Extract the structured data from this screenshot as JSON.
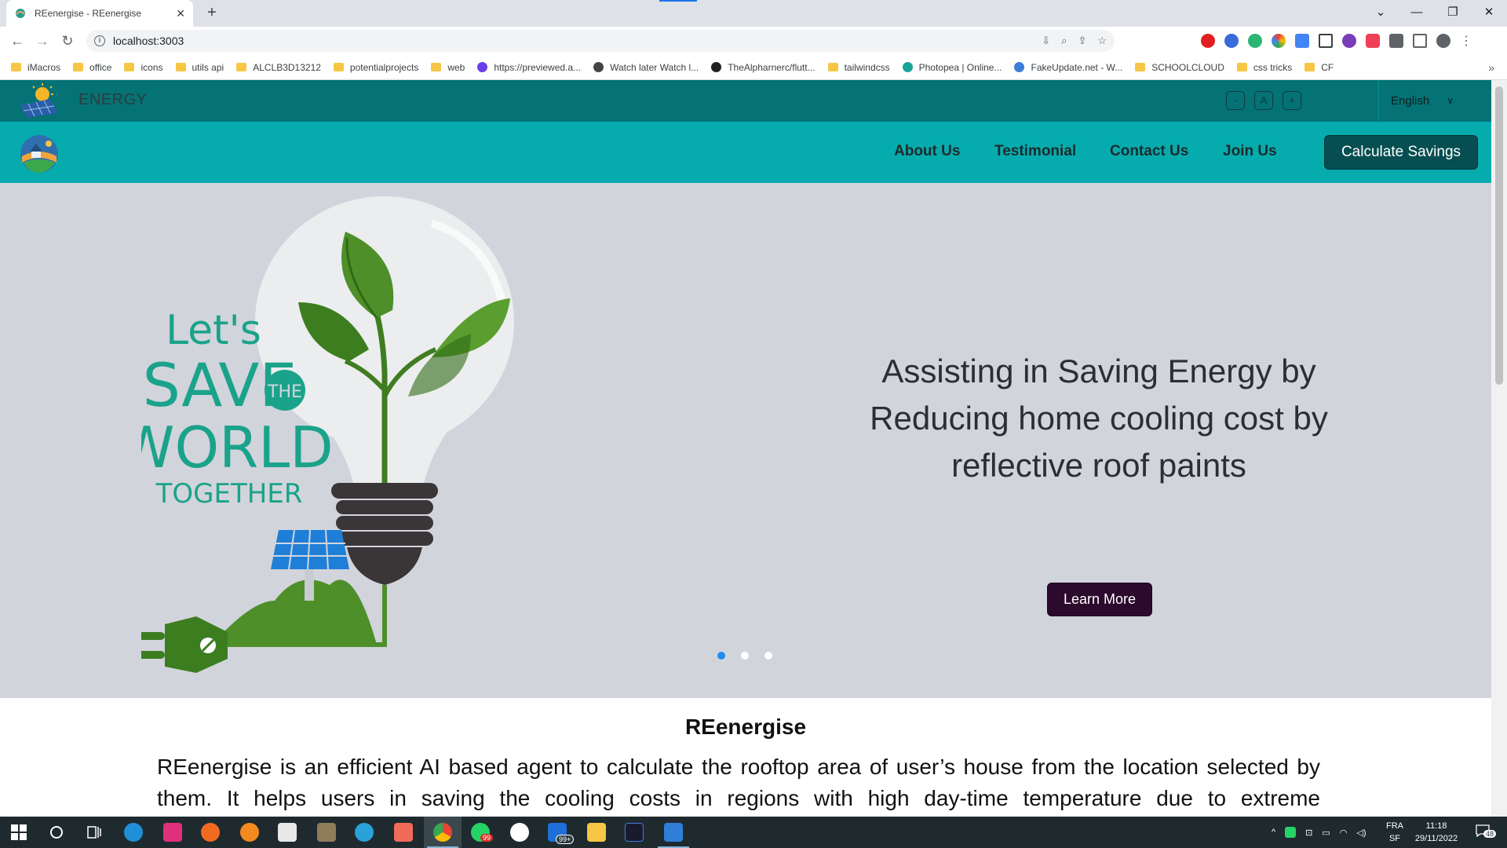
{
  "browser": {
    "tab_title": "REenergise - REenergise",
    "tab_close": "✕",
    "new_tab": "+",
    "url": "localhost:3003",
    "bookmarks": [
      {
        "label": "iMacros",
        "kind": "folder"
      },
      {
        "label": "office",
        "kind": "folder"
      },
      {
        "label": "icons",
        "kind": "folder"
      },
      {
        "label": "utils api",
        "kind": "folder"
      },
      {
        "label": "ALCLB3D13212",
        "kind": "folder"
      },
      {
        "label": "potentialprojects",
        "kind": "folder"
      },
      {
        "label": "web",
        "kind": "folder"
      },
      {
        "label": "https://previewed.a...",
        "kind": "site",
        "color": "#6a3de8"
      },
      {
        "label": "Watch later Watch l...",
        "kind": "site",
        "color": "#444444"
      },
      {
        "label": "TheAlpharnerc/flutt...",
        "kind": "site",
        "color": "#222222"
      },
      {
        "label": "tailwindcss",
        "kind": "folder"
      },
      {
        "label": "Photopea | Online...",
        "kind": "site",
        "color": "#18a497"
      },
      {
        "label": "FakeUpdate.net - W...",
        "kind": "site",
        "color": "#3b7dd8"
      },
      {
        "label": "SCHOOLCLOUD",
        "kind": "folder"
      },
      {
        "label": "css tricks",
        "kind": "folder"
      },
      {
        "label": "CF",
        "kind": "folder"
      }
    ],
    "bookmarks_more": "»"
  },
  "site": {
    "brand_name": "ENERGY",
    "font_controls": [
      "-",
      "A",
      "+"
    ],
    "language": "English",
    "nav_links": [
      "About Us",
      "Testimonial",
      "Contact Us",
      "Join Us"
    ],
    "cta_label": "Calculate Savings",
    "hero": {
      "art_text": {
        "lets": "Let's",
        "save": "SAVE",
        "the": "THE",
        "world": "WORLD",
        "together": "TOGETHER"
      },
      "headline": "Assisting in Saving Energy by Reducing home cooling cost by reflective roof paints",
      "button_label": "Learn More",
      "slides": 3,
      "active_slide": 1
    },
    "about": {
      "title": "REenergise",
      "body": "REenergise is an efficient AI based agent to calculate the rooftop area of user’s house from the location selected by them. It helps users in saving the cooling costs in regions with high day-time temperature due to extreme"
    }
  },
  "taskbar": {
    "mail_badge": "99+",
    "whatsapp_badge": "99",
    "lang_line1": "FRA",
    "lang_line2": "SF",
    "time": "11:18",
    "date": "29/11/2022",
    "notifications": "48"
  },
  "colors": {
    "topbar": "#057275",
    "nav": "#06abae",
    "cta": "#064e51",
    "hero_bg": "#d2d4dc",
    "learn_btn": "#2c0a2d",
    "art_green": "#1aa38a"
  }
}
